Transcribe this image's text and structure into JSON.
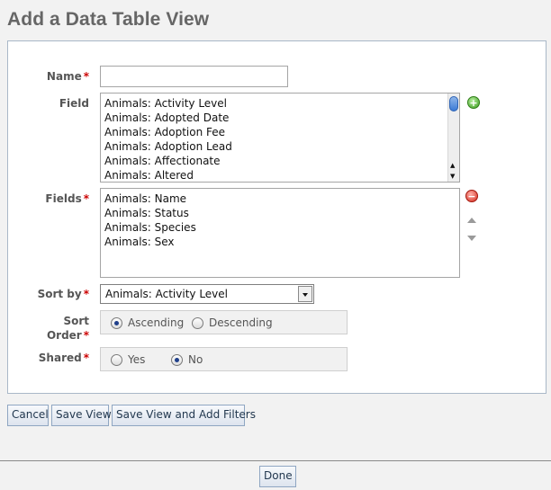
{
  "page": {
    "title": "Add a Data Table View"
  },
  "form": {
    "name_label": "Name",
    "name_value": "",
    "field_label": "Field",
    "field_options": [
      "Animals: Activity Level",
      "Animals: Adopted Date",
      "Animals: Adoption Fee",
      "Animals: Adoption Lead",
      "Animals: Affectionate",
      "Animals: Altered"
    ],
    "fields_label": "Fields",
    "fields_selected": [
      "Animals: Name",
      "Animals: Status",
      "Animals: Species",
      "Animals: Sex"
    ],
    "sort_by_label": "Sort by",
    "sort_by_value": "Animals: Activity Level",
    "sort_order_label_1": "Sort",
    "sort_order_label_2": "Order",
    "sort_order_options": [
      "Ascending",
      "Descending"
    ],
    "sort_order_selected": "Ascending",
    "shared_label": "Shared",
    "shared_options": [
      "Yes",
      "No"
    ],
    "shared_selected": "No",
    "required_marker": "*"
  },
  "buttons": {
    "cancel": "Cancel",
    "save_view": "Save View",
    "save_view_add_filters": "Save View and Add Filters",
    "done": "Done"
  },
  "icons": {
    "add": "plus-circle-icon",
    "remove": "minus-circle-icon",
    "move_up": "triangle-up-icon",
    "move_down": "triangle-down-icon"
  },
  "colors": {
    "required": "#cc0000",
    "panel_border": "#a9b8c8",
    "add_icon": "#3a9a1e",
    "remove_icon": "#d42a1d",
    "scroll_thumb": "#3b7ad6"
  }
}
